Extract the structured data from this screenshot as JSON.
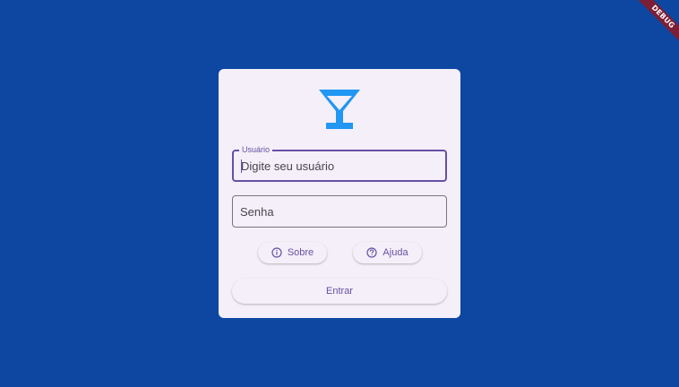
{
  "debug_banner": "DEBUG",
  "login": {
    "logo_icon": "cocktail-glass-icon",
    "username": {
      "label": "Usuário",
      "placeholder": "Digite seu usuário",
      "value": ""
    },
    "password": {
      "placeholder": "Senha",
      "value": ""
    },
    "about_button": {
      "icon": "info-icon",
      "label": "Sobre"
    },
    "help_button": {
      "icon": "help-icon",
      "label": "Ajuda"
    },
    "submit_label": "Entrar"
  },
  "colors": {
    "background": "#0d47a1",
    "card": "#f4eff8",
    "accent": "#6750a4",
    "logo": "#2196f3",
    "debug_ribbon": "#7b1e36"
  }
}
